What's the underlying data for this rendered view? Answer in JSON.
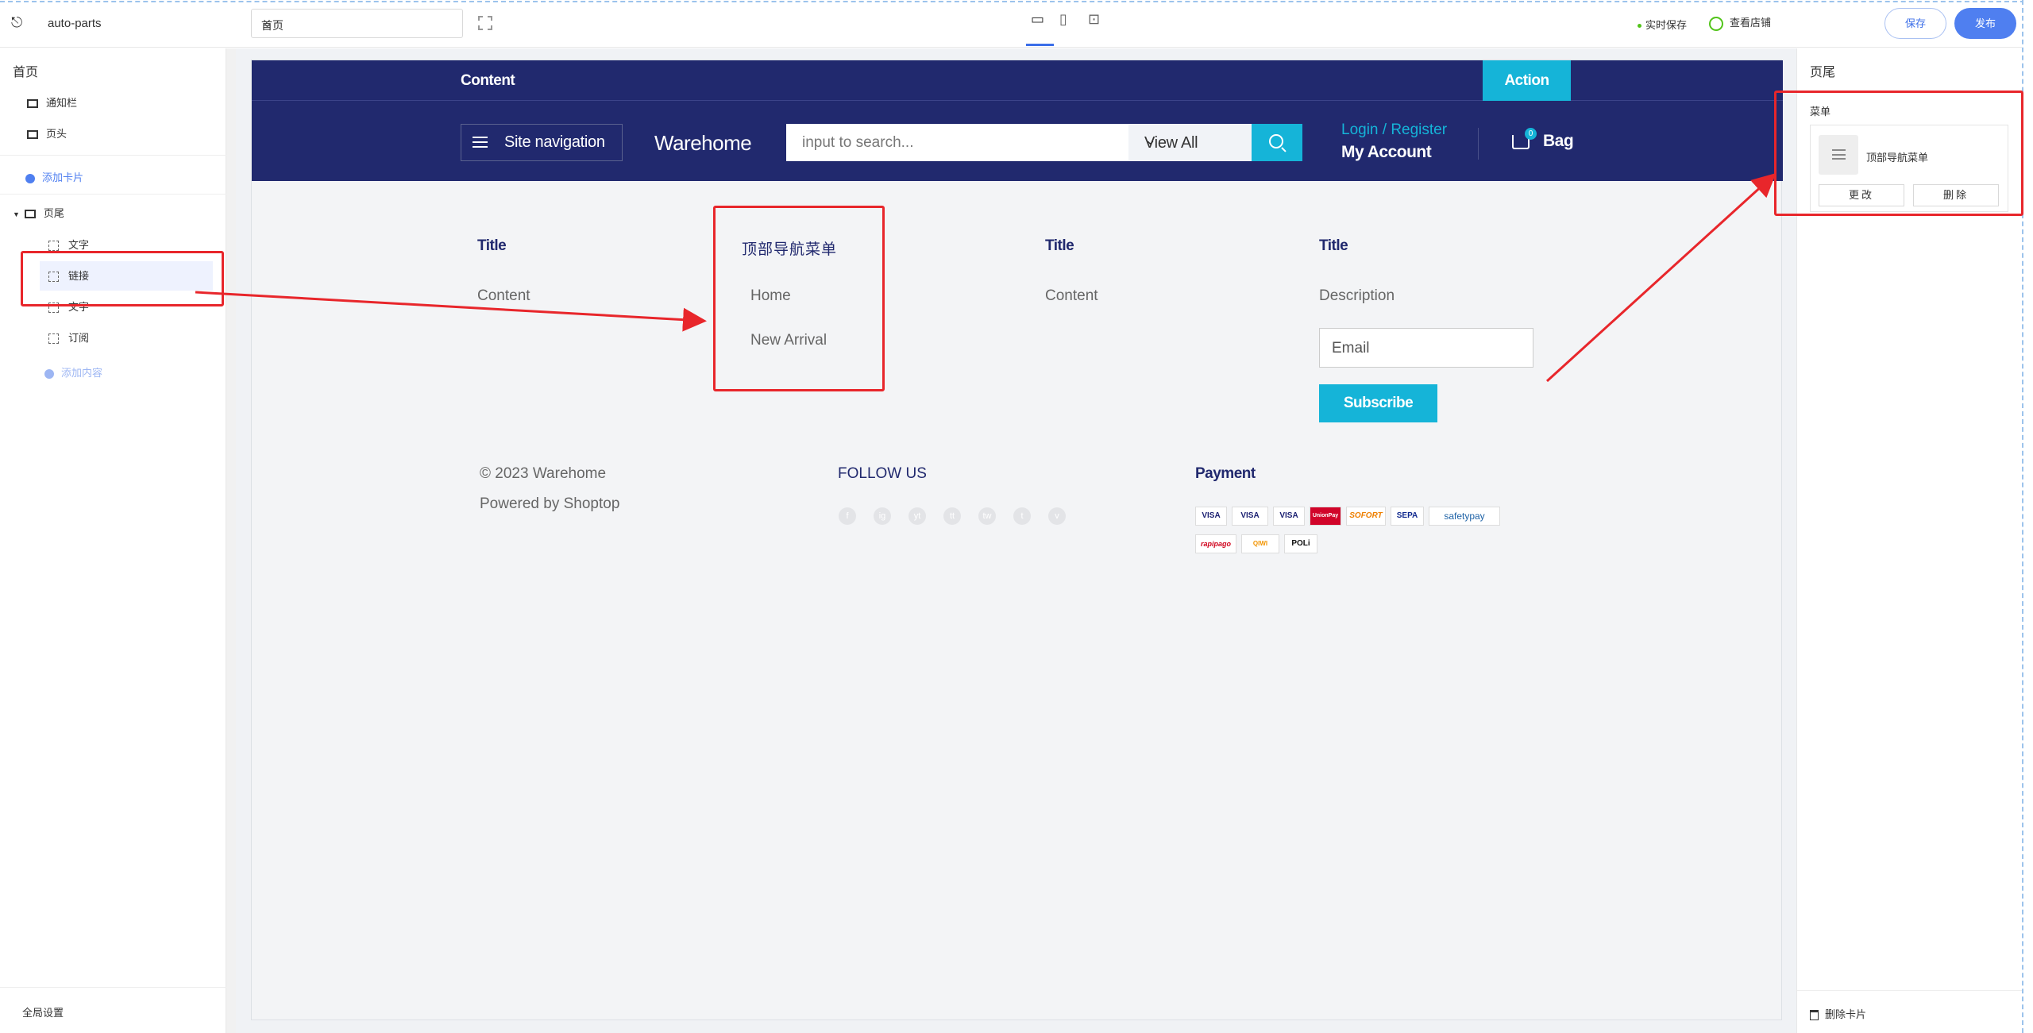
{
  "topbar": {
    "store_name": "auto-parts",
    "page_select": "首页",
    "autosave": "实时保存",
    "view_store": "查看店铺",
    "save": "保存",
    "publish": "发布"
  },
  "left": {
    "title": "首页",
    "items": [
      {
        "label": "通知栏",
        "icon": "notice-bar-icon"
      },
      {
        "label": "页头",
        "icon": "header-icon"
      }
    ],
    "add_card": "添加卡片",
    "footer_label": "页尾",
    "footer_children": [
      "文字",
      "链接",
      "文字",
      "订阅"
    ],
    "add_content": "添加内容",
    "global_settings": "全局设置"
  },
  "site": {
    "announcement": "Content",
    "action": "Action",
    "nav_button": "Site navigation",
    "logo": "Warehome",
    "search_placeholder": "input to search...",
    "search_category": "View All",
    "login": "Login / Register",
    "account": "My Account",
    "cart_count": "0",
    "bag": "Bag",
    "footer": {
      "col1": {
        "title": "Title",
        "text": "Content"
      },
      "col2": {
        "title": "顶部导航菜单",
        "links": [
          "Home",
          "New Arrival"
        ]
      },
      "col3": {
        "title": "Title",
        "text": "Content"
      },
      "col4": {
        "title": "Title",
        "text": "Description",
        "email_placeholder": "Email",
        "subscribe": "Subscribe"
      },
      "copyright": "© 2023 Warehome",
      "powered": "Powered by Shoptop",
      "follow": "FOLLOW US",
      "social": [
        "f",
        "ig",
        "yt",
        "tt",
        "tw",
        "t",
        "v"
      ],
      "payment_title": "Payment",
      "payments": [
        "VISA",
        "VISA",
        "VISA",
        "UnionPay",
        "SOFORT",
        "SEPA",
        "safetypay",
        "rapipago",
        "QIWI",
        "POLi"
      ]
    }
  },
  "right": {
    "title": "页尾",
    "menu_label": "菜单",
    "menu_name": "顶部导航菜单",
    "change": "更改",
    "delete": "删除",
    "delete_card": "删除卡片"
  },
  "colors": {
    "brand_navy": "#21296e",
    "accent_cyan": "#15b4d8",
    "editor_blue": "#4f7ff0",
    "annotation_red": "#e8262b"
  }
}
